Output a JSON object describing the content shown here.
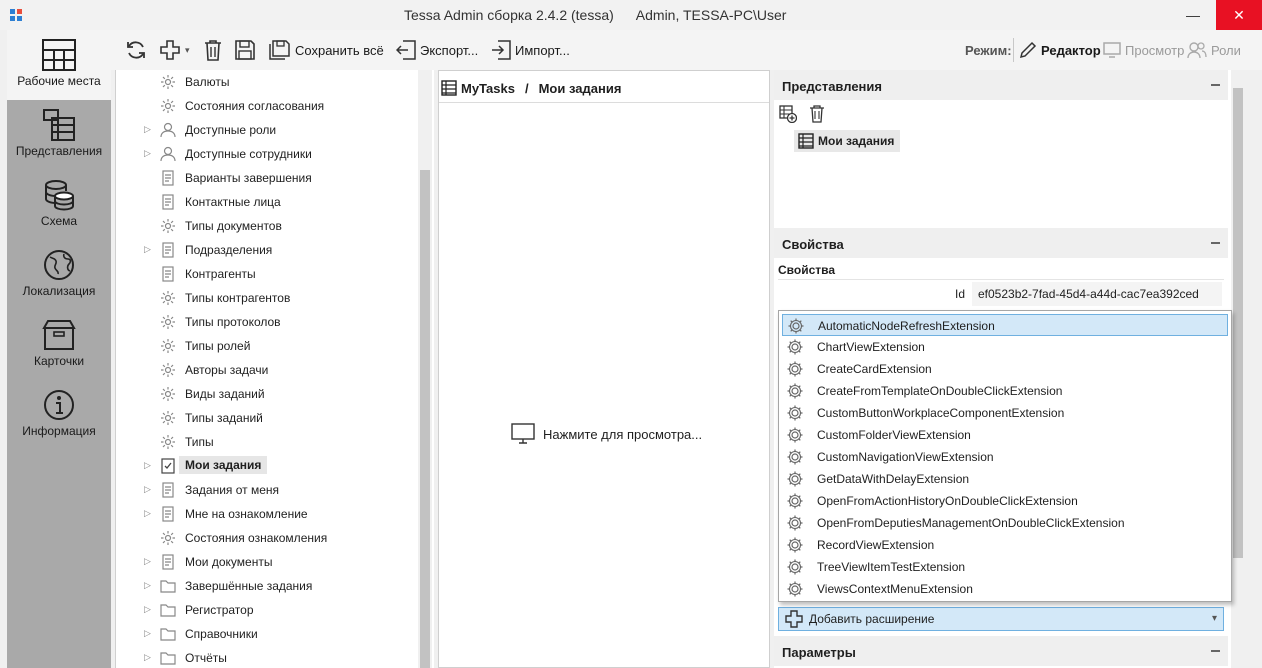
{
  "window": {
    "title": "Tessa Admin сборка 2.4.2 (tessa)",
    "user": "Admin, TESSA-PC\\User",
    "minimize_glyph": "—",
    "close_glyph": "✕"
  },
  "leftnav": {
    "items": [
      {
        "label": "Рабочие места",
        "icon": "workplaces-icon"
      },
      {
        "label": "Представления",
        "icon": "views-icon"
      },
      {
        "label": "Схема",
        "icon": "database-icon"
      },
      {
        "label": "Локализация",
        "icon": "globe-icon"
      },
      {
        "label": "Карточки",
        "icon": "box-icon"
      },
      {
        "label": "Информация",
        "icon": "info-icon"
      }
    ]
  },
  "toolbar": {
    "save_all": "Сохранить всё",
    "export": "Экспорт...",
    "import": "Импорт...",
    "mode_label": "Режим:",
    "editor": "Редактор",
    "preview": "Просмотр",
    "roles": "Роли"
  },
  "tree": {
    "items": [
      {
        "label": "Валюты",
        "expandable": false
      },
      {
        "label": "Состояния согласования",
        "expandable": false
      },
      {
        "label": "Доступные роли",
        "expandable": true
      },
      {
        "label": "Доступные сотрудники",
        "expandable": true
      },
      {
        "label": "Варианты завершения",
        "expandable": false
      },
      {
        "label": "Контактные лица",
        "expandable": false
      },
      {
        "label": "Типы документов",
        "expandable": false
      },
      {
        "label": "Подразделения",
        "expandable": true
      },
      {
        "label": "Контрагенты",
        "expandable": false
      },
      {
        "label": "Типы контрагентов",
        "expandable": false
      },
      {
        "label": "Типы протоколов",
        "expandable": false
      },
      {
        "label": "Типы ролей",
        "expandable": false
      },
      {
        "label": "Авторы задачи",
        "expandable": false
      },
      {
        "label": "Виды заданий",
        "expandable": false
      },
      {
        "label": "Типы заданий",
        "expandable": false
      },
      {
        "label": "Типы",
        "expandable": false
      },
      {
        "label": "Мои задания",
        "expandable": true,
        "selected": true
      },
      {
        "label": "Задания от меня",
        "expandable": true
      },
      {
        "label": "Мне на ознакомление",
        "expandable": true
      },
      {
        "label": "Состояния ознакомления",
        "expandable": false
      },
      {
        "label": "Мои документы",
        "expandable": true
      },
      {
        "label": "Завершённые задания",
        "expandable": true
      },
      {
        "label": "Регистратор",
        "expandable": true
      },
      {
        "label": "Справочники",
        "expandable": true
      },
      {
        "label": "Отчёты",
        "expandable": true
      }
    ]
  },
  "center": {
    "crumb_root": "MyTasks",
    "crumb_sep": "/",
    "crumb_current": "Мои задания",
    "hint": "Нажмите для просмотра..."
  },
  "right": {
    "views_header": "Представления",
    "view_item": "Мои задания",
    "props_header": "Свойства",
    "props_label": "Свойства",
    "id_label": "Id",
    "id_value": "ef0523b2-7fad-45d4-a44d-cac7ea392ced",
    "params_header": "Параметры",
    "add_extension": "Добавить расширение"
  },
  "extensions": [
    "AutomaticNodeRefreshExtension",
    "ChartViewExtension",
    "CreateCardExtension",
    "CreateFromTemplateOnDoubleClickExtension",
    "CustomButtonWorkplaceComponentExtension",
    "CustomFolderViewExtension",
    "CustomNavigationViewExtension",
    "GetDataWithDelayExtension",
    "OpenFromActionHistoryOnDoubleClickExtension",
    "OpenFromDeputiesManagementOnDoubleClickExtension",
    "RecordViewExtension",
    "TreeViewItemTestExtension",
    "ViewsContextMenuExtension"
  ],
  "colors": {
    "close_button": "#e81123",
    "nav_bg": "#a9a9a9",
    "highlight": "#d3e8f8",
    "highlight_border": "#6fb0e0"
  }
}
